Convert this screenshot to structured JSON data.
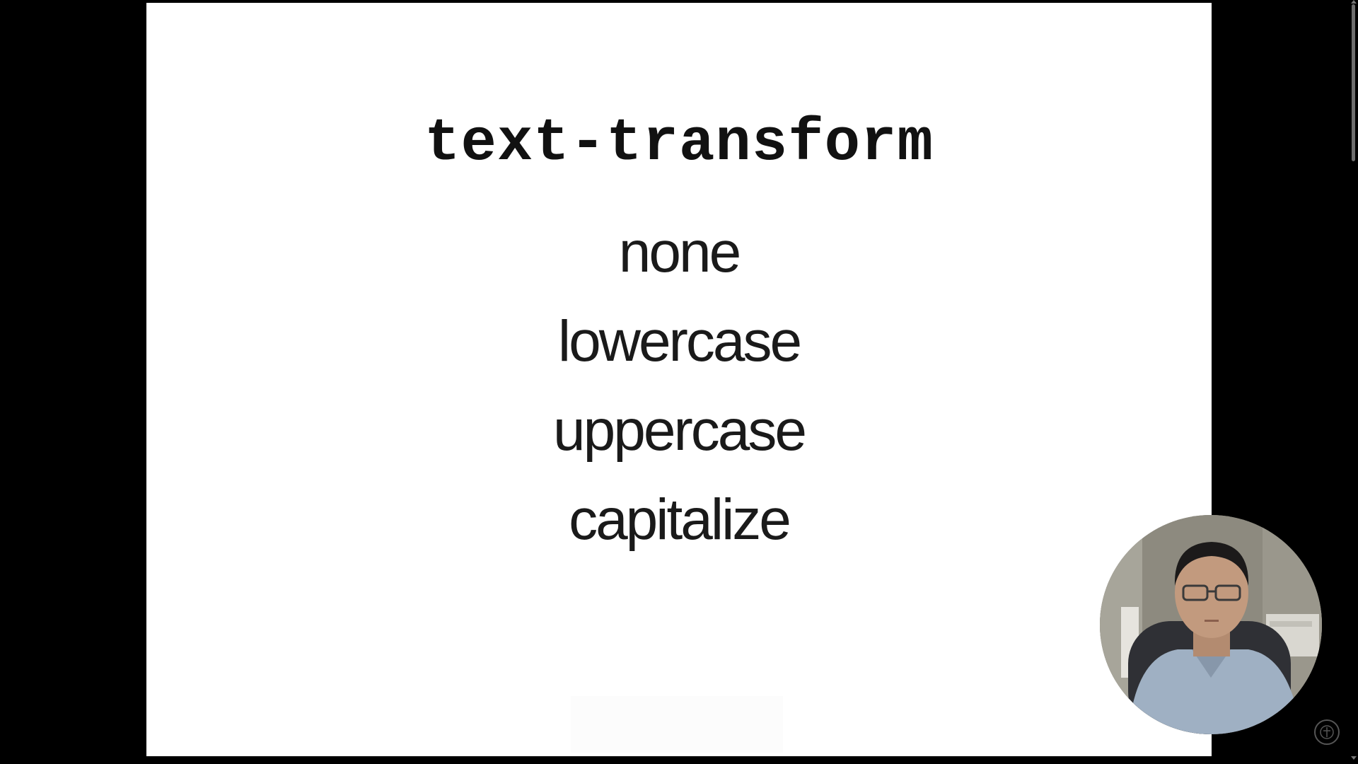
{
  "slide": {
    "title": "text-transform",
    "values": [
      "none",
      "lowercase",
      "uppercase",
      "capitalize"
    ]
  },
  "overlay": {
    "webcam_icon": "presenter-webcam",
    "watermark_icon": "channel-watermark-icon"
  },
  "colors": {
    "background": "#000000",
    "slide": "#ffffff",
    "text": "#111111"
  }
}
